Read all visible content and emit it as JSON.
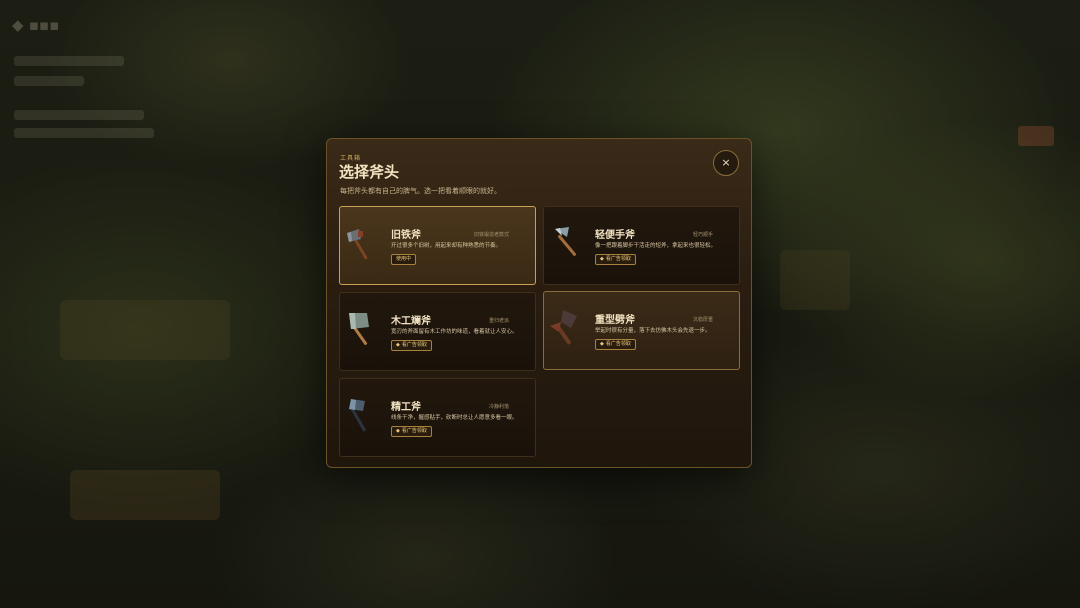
{
  "dialog": {
    "eyebrow": "工具箱",
    "title": "选择斧头",
    "subtitle": "每把斧头都有自己的脾气。选一把看着顺眼的就好。",
    "close_icon": "×"
  },
  "axes": [
    {
      "name": "旧铁斧",
      "tag": "旧铁锻造老款式",
      "desc": "开过很多个旧树，用起来却有种熟悉的节奏。",
      "badge": "使用中",
      "state": "equipped",
      "icon": "rusty-axe-icon"
    },
    {
      "name": "轻便手斧",
      "tag": "轻巧顺手",
      "desc": "像一把跟着脚步干活走的短斧，拿起来也很轻松。",
      "badge": "看广告领取",
      "state": "locked",
      "icon": "hand-axe-icon"
    },
    {
      "name": "木工斓斧",
      "tag": "重归老派",
      "desc": "宽刃的斧面留有木工作坊的味道，看着就让人安心。",
      "badge": "看广告领取",
      "state": "locked",
      "icon": "carpenter-axe-icon"
    },
    {
      "name": "重型劈斧",
      "tag": "沉稳厚重",
      "desc": "举起时很有分量，落下去仿佛木头会先退一步。",
      "badge": "看广告领取",
      "state": "locked",
      "icon": "heavy-axe-icon"
    },
    {
      "name": "精工斧",
      "tag": "冷静利落",
      "desc": "线条干净，握感贴手，砍断时总让人愿意多看一眼。",
      "badge": "看广告领取",
      "state": "locked",
      "icon": "precision-axe-icon"
    }
  ]
}
